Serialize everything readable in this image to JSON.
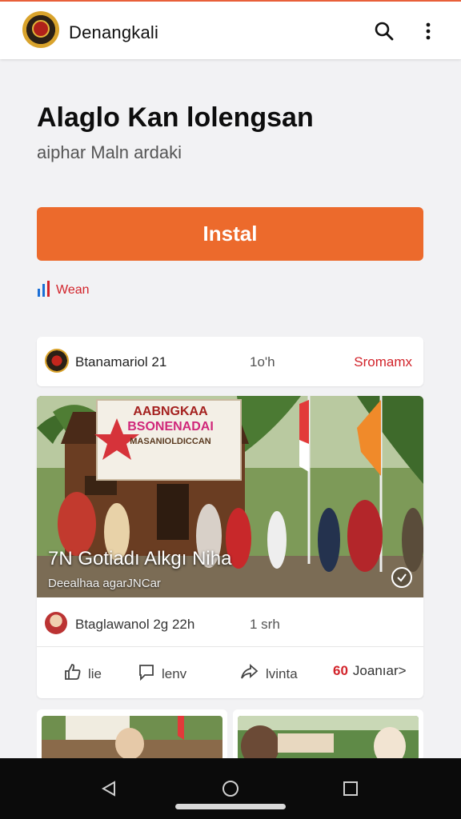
{
  "appbar": {
    "title": "Denangkali",
    "icons": [
      "logo-emblem",
      "search-icon",
      "more-vert-icon"
    ]
  },
  "hero": {
    "title": "Alaglo Kan lolengsan",
    "subtitle": "aiphar Maln ardaki"
  },
  "install": {
    "label": "Instal"
  },
  "stat": {
    "label": "Wean",
    "icon": "bar-chart-icon"
  },
  "header_card": {
    "name": "Btanamariol 21",
    "time": "1o'h",
    "link": "Sromamx"
  },
  "post": {
    "banner_lines": [
      "AABNGKAA",
      "BSONENADAI",
      "MASANIOLDICCAN"
    ],
    "caption": "7N Gotiadı Alkgı Niha",
    "subcaption": "Deealhaa agarJNCar",
    "meta_name": "Btaglawanol 2g  22h",
    "meta_time": "1 srh",
    "actions": {
      "like": "lie",
      "comment": "lenv",
      "share": "lvinta",
      "more_count": "60",
      "more": "Joanıar>"
    }
  },
  "colors": {
    "accent": "#ec6a2c",
    "link_red": "#d2232a",
    "background": "#f2f2f4",
    "navbar": "#0b0b0b"
  }
}
